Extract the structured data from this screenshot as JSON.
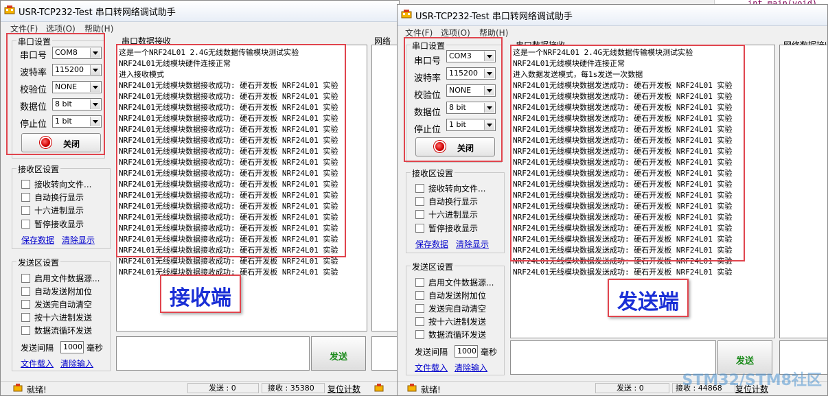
{
  "receiver": {
    "title": "USR-TCP232-Test 串口转网络调试助手",
    "menu": [
      "文件(F)",
      "选项(O)",
      "帮助(H)"
    ],
    "serial_group_title": "串口设置",
    "port_label": "串口号",
    "port_value": "COM8",
    "baud_label": "波特率",
    "baud_value": "115200",
    "parity_label": "校验位",
    "parity_value": "NONE",
    "databits_label": "数据位",
    "databits_value": "8 bit",
    "stopbits_label": "停止位",
    "stopbits_value": "1 bit",
    "close_label": "关闭",
    "rx_group_title": "接收区设置",
    "rx_options": [
      "接收转向文件...",
      "自动换行显示",
      "十六进制显示",
      "暂停接收显示"
    ],
    "save_data": "保存数据",
    "clear_display": "清除显示",
    "tx_group_title": "发送区设置",
    "tx_options": [
      "启用文件数据源...",
      "自动发送附加位",
      "发送完自动清空",
      "按十六进制发送",
      "数据流循环发送"
    ],
    "interval_label": "发送间隔",
    "interval_value": "1000",
    "interval_unit": "毫秒",
    "file_load": "文件载入",
    "clear_input": "清除输入",
    "panel_title": "串口数据接收",
    "net_panel_title": "网络",
    "rx_lines": [
      "这是一个NRF24L01 2.4G无线数据传输模块测试实验",
      "NRF24L01无线模块硬件连接正常",
      "进入接收模式",
      "NRF24L01无线模块数据接收成功: 硬石开发板 NRF24L01 实验",
      "NRF24L01无线模块数据接收成功: 硬石开发板 NRF24L01 实验",
      "NRF24L01无线模块数据接收成功: 硬石开发板 NRF24L01 实验",
      "NRF24L01无线模块数据接收成功: 硬石开发板 NRF24L01 实验",
      "NRF24L01无线模块数据接收成功: 硬石开发板 NRF24L01 实验",
      "NRF24L01无线模块数据接收成功: 硬石开发板 NRF24L01 实验",
      "NRF24L01无线模块数据接收成功: 硬石开发板 NRF24L01 实验",
      "NRF24L01无线模块数据接收成功: 硬石开发板 NRF24L01 实验",
      "NRF24L01无线模块数据接收成功: 硬石开发板 NRF24L01 实验",
      "NRF24L01无线模块数据接收成功: 硬石开发板 NRF24L01 实验",
      "NRF24L01无线模块数据接收成功: 硬石开发板 NRF24L01 实验",
      "NRF24L01无线模块数据接收成功: 硬石开发板 NRF24L01 实验",
      "NRF24L01无线模块数据接收成功: 硬石开发板 NRF24L01 实验",
      "NRF24L01无线模块数据接收成功: 硬石开发板 NRF24L01 实验",
      "NRF24L01无线模块数据接收成功: 硬石开发板 NRF24L01 实验",
      "NRF24L01无线模块数据接收成功: 硬石开发板 NRF24L01 实验",
      "NRF24L01无线模块数据接收成功: 硬石开发板 NRF24L01 实验",
      "NRF24L01无线模块数据接收成功: 硬石开发板 NRF24L01 实验"
    ],
    "big_label": "接收端",
    "send_button": "发送",
    "status_ready": "就绪!",
    "status_sent": "发送 : 0",
    "status_received": "接收 : 35380",
    "status_reset": "复位计数"
  },
  "sender": {
    "title": "USR-TCP232-Test 串口转网络调试助手",
    "menu": [
      "文件(F)",
      "选项(O)",
      "帮助(H)"
    ],
    "serial_group_title": "串口设置",
    "port_label": "串口号",
    "port_value": "COM3",
    "baud_label": "波特率",
    "baud_value": "115200",
    "parity_label": "校验位",
    "parity_value": "NONE",
    "databits_label": "数据位",
    "databits_value": "8 bit",
    "stopbits_label": "停止位",
    "stopbits_value": "1 bit",
    "close_label": "关闭",
    "rx_group_title": "接收区设置",
    "rx_options": [
      "接收转向文件...",
      "自动换行显示",
      "十六进制显示",
      "暂停接收显示"
    ],
    "save_data": "保存数据",
    "clear_display": "清除显示",
    "tx_group_title": "发送区设置",
    "tx_options": [
      "启用文件数据源...",
      "自动发送附加位",
      "发送完自动清空",
      "按十六进制发送",
      "数据流循环发送"
    ],
    "interval_label": "发送间隔",
    "interval_value": "1000",
    "interval_unit": "毫秒",
    "file_load": "文件载入",
    "clear_input": "清除输入",
    "panel_title": "串口数据接收",
    "net_panel_title": "网络数据接收",
    "rx_lines": [
      "这是一个NRF24L01 2.4G无线数据传输模块测试实验",
      "NRF24L01无线模块硬件连接正常",
      "进入数据发送模式，每1s发送一次数据",
      "NRF24L01无线模块数据发送成功: 硬石开发板 NRF24L01 实验",
      "NRF24L01无线模块数据发送成功: 硬石开发板 NRF24L01 实验",
      "NRF24L01无线模块数据发送成功: 硬石开发板 NRF24L01 实验",
      "NRF24L01无线模块数据发送成功: 硬石开发板 NRF24L01 实验",
      "NRF24L01无线模块数据发送成功: 硬石开发板 NRF24L01 实验",
      "NRF24L01无线模块数据发送成功: 硬石开发板 NRF24L01 实验",
      "NRF24L01无线模块数据发送成功: 硬石开发板 NRF24L01 实验",
      "NRF24L01无线模块数据发送成功: 硬石开发板 NRF24L01 实验",
      "NRF24L01无线模块数据发送成功: 硬石开发板 NRF24L01 实验",
      "NRF24L01无线模块数据发送成功: 硬石开发板 NRF24L01 实验",
      "NRF24L01无线模块数据发送成功: 硬石开发板 NRF24L01 实验",
      "NRF24L01无线模块数据发送成功: 硬石开发板 NRF24L01 实验",
      "NRF24L01无线模块数据发送成功: 硬石开发板 NRF24L01 实验",
      "NRF24L01无线模块数据发送成功: 硬石开发板 NRF24L01 实验",
      "NRF24L01无线模块数据发送成功: 硬石开发板 NRF24L01 实验",
      "NRF24L01无线模块数据发送成功: 硬石开发板 NRF24L01 实验",
      "NRF24L01无线模块数据发送成功: 硬石开发板 NRF24L01 实验",
      "NRF24L01无线模块数据发送成功: 硬石开发板 NRF24L01 实验"
    ],
    "big_label": "发送端",
    "send_button": "发送",
    "status_ready": "就绪!",
    "status_sent": "发送 : 0",
    "status_received": "接收 : 44868",
    "status_reset": "复位计数"
  },
  "background_code": "int main(void)",
  "watermark": "STM32/STM8社区",
  "colors": {
    "annotation_red": "#e0444d",
    "label_blue": "#1a2fd6",
    "send_green": "#1a8a1a"
  }
}
